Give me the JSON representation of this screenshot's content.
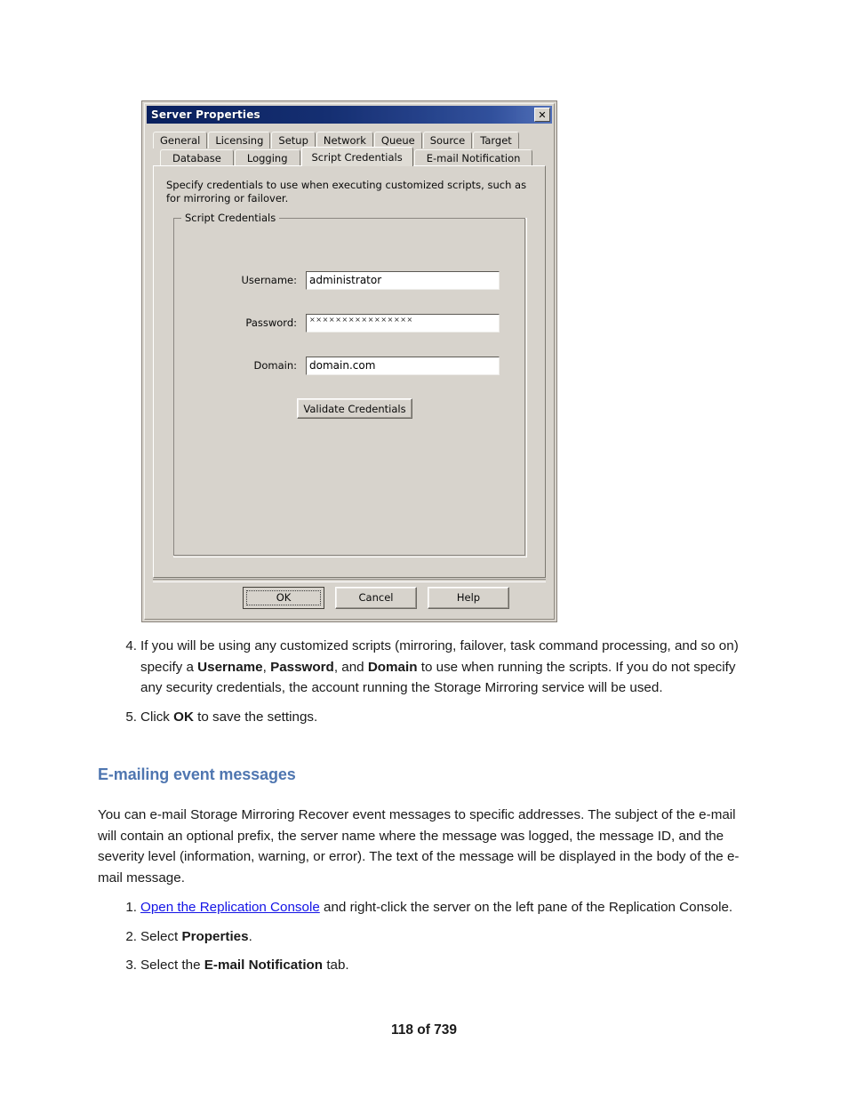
{
  "dialog": {
    "title": "Server Properties",
    "close_icon": "close-icon",
    "close_label": "✕",
    "tabs_row1": [
      {
        "label": "General",
        "active": false
      },
      {
        "label": "Licensing",
        "active": false
      },
      {
        "label": "Setup",
        "active": false
      },
      {
        "label": "Network",
        "active": false
      },
      {
        "label": "Queue",
        "active": false
      },
      {
        "label": "Source",
        "active": false
      },
      {
        "label": "Target",
        "active": false
      }
    ],
    "tabs_row2": [
      {
        "label": "Database",
        "active": false
      },
      {
        "label": "Logging",
        "active": false
      },
      {
        "label": "Script Credentials",
        "active": true
      },
      {
        "label": "E-mail Notification",
        "active": false
      }
    ],
    "description": "Specify credentials to use when executing customized scripts, such as for mirroring or failover.",
    "group_legend": "Script Credentials",
    "fields": [
      {
        "label": "Username:",
        "value": "administrator",
        "masked": false
      },
      {
        "label": "Password:",
        "value": "××××××××××××××××",
        "masked": true
      },
      {
        "label": "Domain:",
        "value": "domain.com",
        "masked": false
      }
    ],
    "validate_button": "Validate Credentials",
    "footer_buttons": [
      {
        "label": "OK",
        "default": true
      },
      {
        "label": "Cancel",
        "default": false
      },
      {
        "label": "Help",
        "default": false
      }
    ]
  },
  "document": {
    "steps_group_a": [
      {
        "num": "4.",
        "html": "If you will be using any customized scripts (mirroring, failover, task command processing, and so on) specify a <b>Username</b>, <b>Password</b>, and <b>Domain</b> to use when running the scripts. If you do not specify any security credentials, the account running the Storage Mirroring service will be used."
      },
      {
        "num": "5.",
        "html": "Click <b>OK</b> to save the settings."
      }
    ],
    "heading": "E-mailing event messages",
    "paragraph": "You can e-mail Storage Mirroring Recover event messages to specific addresses. The subject of the e-mail will contain an optional prefix, the server name where the message was logged, the message ID, and the severity level (information, warning, or error). The text of the message will be displayed in the body of the e-mail message.",
    "steps_group_b": [
      {
        "num": "1.",
        "html": "<a class=\"link\" href=\"#\">Open the Replication Console</a> and right-click the server on the left pane of the Replication Console."
      },
      {
        "num": "2.",
        "html": "Select <b>Properties</b>."
      },
      {
        "num": "3.",
        "html": "Select the <b>E-mail Notification</b> tab."
      }
    ],
    "page_footer": "118 of 739"
  },
  "colors": {
    "heading_blue": "#4f76b0",
    "link_blue": "#1414e6",
    "titlebar_navy": "#0a246a",
    "dialog_face": "#d4d0c8"
  }
}
